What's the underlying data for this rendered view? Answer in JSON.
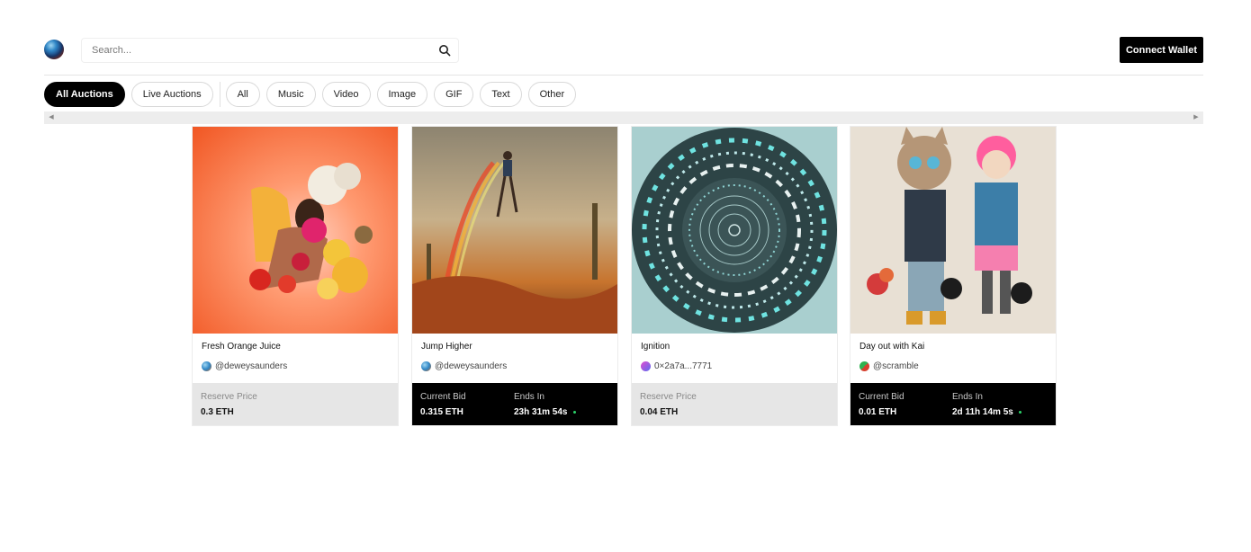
{
  "header": {
    "search_placeholder": "Search...",
    "connect_wallet_label": "Connect Wallet"
  },
  "filters": {
    "auction_tabs": [
      {
        "label": "All Auctions",
        "active": true
      },
      {
        "label": "Live Auctions",
        "active": false
      }
    ],
    "media_types": [
      "All",
      "Music",
      "Video",
      "Image",
      "GIF",
      "Text",
      "Other"
    ]
  },
  "auctions": [
    {
      "title": "Fresh Orange Juice",
      "creator": "@deweysaunders",
      "status": "reserve",
      "price_label": "Reserve Price",
      "price": "0.3 ETH"
    },
    {
      "title": "Jump Higher",
      "creator": "@deweysaunders",
      "status": "live",
      "price_label": "Current Bid",
      "price": "0.315 ETH",
      "ends_label": "Ends In",
      "ends_in": "23h 31m 54s"
    },
    {
      "title": "Ignition",
      "creator": "0×2a7a...7771",
      "status": "reserve",
      "price_label": "Reserve Price",
      "price": "0.04 ETH"
    },
    {
      "title": "Day out with Kai",
      "creator": "@scramble",
      "status": "live",
      "price_label": "Current Bid",
      "price": "0.01 ETH",
      "ends_label": "Ends In",
      "ends_in": "2d 11h 14m 5s"
    }
  ],
  "colors": {
    "primary": "#000000",
    "live_indicator": "#2bd46a",
    "reserve_footer_bg": "#e6e6e6"
  },
  "icons": {
    "logo": "globe-logo-icon",
    "search": "search-icon",
    "scroll_left": "scroll-left-arrow-icon",
    "scroll_right": "scroll-right-arrow-icon"
  }
}
